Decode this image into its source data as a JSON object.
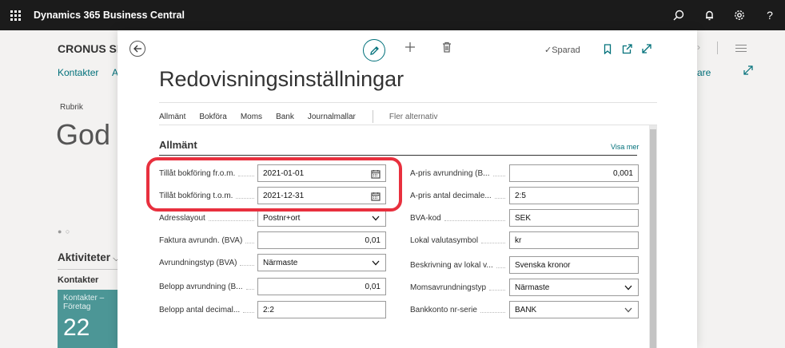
{
  "app": {
    "title": "Dynamics 365 Business Central",
    "icons": [
      "search-icon",
      "bell-icon",
      "gear-icon",
      "help-icon"
    ],
    "help_glyph": "?"
  },
  "background": {
    "company": "CRONUS SI",
    "nav": [
      "Kontakter",
      "A",
      "are"
    ],
    "rubrik": "Rubrik",
    "heading": "God",
    "dots": "● ○",
    "activities": "Aktiviteter",
    "contacts_label": "Kontakter",
    "tile": {
      "label": "Kontakter –\nFöretag",
      "value": "22"
    }
  },
  "modal": {
    "saved_status": "✓Sparad",
    "title": "Redovisningsinställningar",
    "tabs": [
      "Allmänt",
      "Bokföra",
      "Moms",
      "Bank",
      "Journalmallar"
    ],
    "more_options": "Fler alternativ",
    "section": {
      "title": "Allmänt",
      "show_more": "Visa mer"
    },
    "left_fields": [
      {
        "label": "Tillåt bokföring fr.o.m.",
        "value": "2021-01-01",
        "kind": "date"
      },
      {
        "label": "Tillåt bokföring t.o.m.",
        "value": "2021-12-31",
        "kind": "date"
      },
      {
        "label": "Adresslayout",
        "value": "Postnr+ort",
        "kind": "select"
      },
      {
        "label": "Faktura avrundn. (BVA)",
        "value": "0,01",
        "kind": "number"
      },
      {
        "label": "Avrundningstyp (BVA)",
        "value": "Närmaste",
        "kind": "select"
      },
      {
        "label": "Belopp avrundning (B...",
        "value": "0,01",
        "kind": "number"
      },
      {
        "label": "Belopp antal decimal...",
        "value": "2:2",
        "kind": "text"
      }
    ],
    "right_fields": [
      {
        "label": "A-pris avrundning (B...",
        "value": "0,001",
        "kind": "number"
      },
      {
        "label": "A-pris antal decimale...",
        "value": "2:5",
        "kind": "text"
      },
      {
        "label": "BVA-kod",
        "value": "SEK",
        "kind": "text"
      },
      {
        "label": "Lokal valutasymbol",
        "value": "kr",
        "kind": "text"
      },
      {
        "label": "Beskrivning av lokal v...",
        "value": "Svenska kronor",
        "kind": "text"
      },
      {
        "label": "Momsavrundningstyp",
        "value": "Närmaste",
        "kind": "select"
      },
      {
        "label": "Bankkonto nr-serie",
        "value": "BANK",
        "kind": "lookup"
      }
    ]
  },
  "colors": {
    "topbar": "#1b1b1b",
    "accent": "#00707a",
    "tile": "#4c9696",
    "highlight": "#e8303e"
  }
}
